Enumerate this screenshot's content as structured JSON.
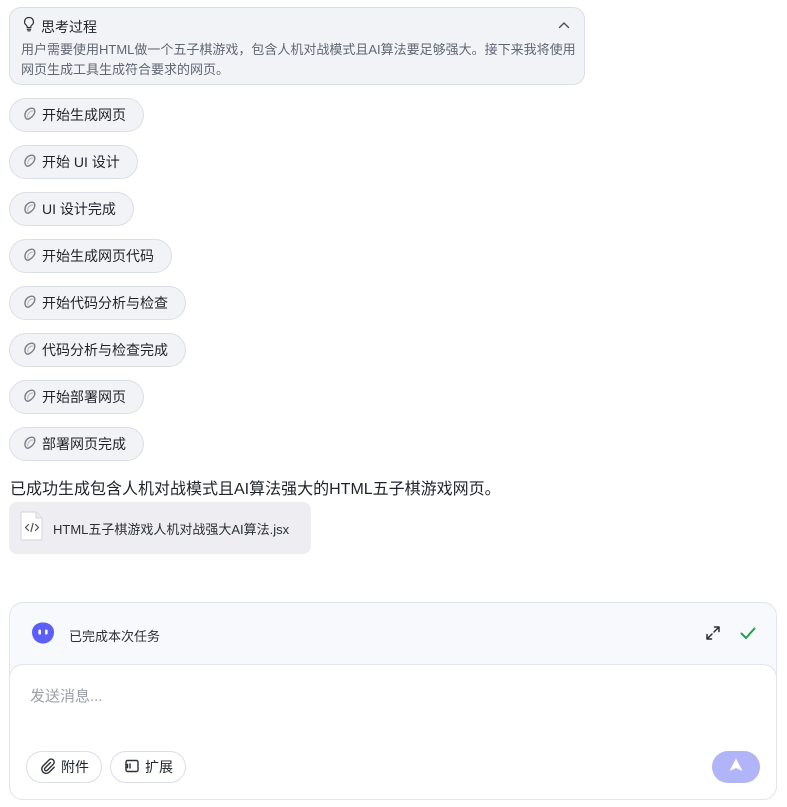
{
  "thinking": {
    "title": "思考过程",
    "body": "用户需要使用HTML做一个五子棋游戏，包含人机对战模式且AI算法要足够强大。接下来我将使用网页生成工具生成符合要求的网页。"
  },
  "steps": [
    {
      "label": "开始生成网页"
    },
    {
      "label": "开始 UI 设计"
    },
    {
      "label": "UI 设计完成"
    },
    {
      "label": "开始生成网页代码"
    },
    {
      "label": "开始代码分析与检查"
    },
    {
      "label": "代码分析与检查完成"
    },
    {
      "label": "开始部署网页"
    },
    {
      "label": "部署网页完成"
    }
  ],
  "result": {
    "text": "已成功生成包含人机对战模式且AI算法强大的HTML五子棋游戏网页。",
    "file_name": "HTML五子棋游戏人机对战强大AI算法.jsx"
  },
  "panel": {
    "status": "已完成本次任务",
    "input_placeholder": "发送消息...",
    "attach_label": "附件",
    "extend_label": "扩展"
  },
  "colors": {
    "accent": "#5b5ff7",
    "send_button": "#b2b4f8",
    "success": "#22a04b"
  },
  "icons": {
    "thinking": "lightbulb-icon",
    "collapse": "chevron-up-icon",
    "step": "spinner-icon",
    "file": "code-file-icon",
    "assistant": "bot-avatar-icon",
    "expand": "expand-icon",
    "done": "check-icon",
    "attach": "paperclip-icon",
    "extend": "plugin-icon",
    "send": "send-arrow-icon"
  }
}
